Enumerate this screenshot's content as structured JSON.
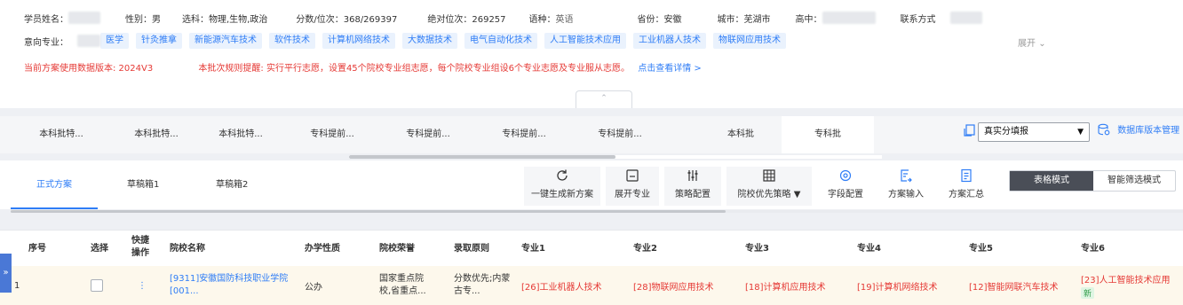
{
  "student": {
    "name_label": "学员姓名：",
    "gender_label": "性别：男",
    "subjects_label": "选科：物理,生物,政治",
    "score_label": "分数/位次：368/269397",
    "absolute_rank_label": "绝对位次：269257",
    "language_label": "语种：",
    "language_value": "英语",
    "province_label": "省份：安徽",
    "city_label": "城市：芜湖市",
    "highschool_label": "高中：",
    "contact_label": "联系方式"
  },
  "intent": {
    "label": "意向专业：",
    "majors": [
      "医学",
      "针灸推拿",
      "新能源汽车技术",
      "软件技术",
      "计算机网络技术",
      "大数据技术",
      "电气自动化技术",
      "人工智能技术应用",
      "工业机器人技术",
      "物联网应用技术"
    ],
    "expand_label": "展开"
  },
  "notice": {
    "data_version": "当前方案使用数据版本: 2024V3",
    "rule": "本批次规则提醒: 实行平行志愿，设置45个院校专业组志愿，每个院校专业组设6个专业志愿及专业服从志愿。",
    "link": "点击查看详情 >"
  },
  "batch_tabs": [
    "本科批特...",
    "本科批特...",
    "本科批特...",
    "专科提前...",
    "专科提前...",
    "专科提前...",
    "专科提前...",
    "本科批",
    "专科批"
  ],
  "batch_active_index": 8,
  "batch_scroll_fraction": 0.5,
  "mode_select": {
    "value": "真实分填报"
  },
  "db_version_label": "数据库版本管理",
  "plan_tabs": [
    "正式方案",
    "草稿箱1",
    "草稿箱2"
  ],
  "plan_active_index": 0,
  "tools": [
    {
      "label": "一键生成新方案",
      "icon": "refresh-icon"
    },
    {
      "label": "展开专业",
      "icon": "expand-icon"
    },
    {
      "label": "策略配置",
      "icon": "sliders-icon"
    },
    {
      "label": "院校优先策略",
      "icon": "grid-icon"
    },
    {
      "label": "字段配置",
      "icon": "target-icon"
    },
    {
      "label": "方案输入",
      "icon": "import-icon"
    },
    {
      "label": "方案汇总",
      "icon": "document-icon"
    }
  ],
  "view_modes": {
    "active": "表格模式",
    "inactive": "智能筛选模式"
  },
  "table_scroll_fraction": 0.61,
  "table": {
    "headers": [
      "序号",
      "选择",
      "快捷操作",
      "院校名称",
      "办学性质",
      "院校荣誉",
      "录取原则",
      "专业1",
      "专业2",
      "专业3",
      "专业4",
      "专业5",
      "专业6"
    ],
    "rows": [
      {
        "index": "1",
        "quick_action": "⋮",
        "school": "[9311]安徽国防科技职业学院[001...",
        "nature": "公办",
        "honors": "国家重点院校,省重点...",
        "principle": "分数优先;内蒙古专...",
        "majors": [
          "[26]工业机器人技术",
          "[28]物联网应用技术",
          "[18]计算机应用技术",
          "[19]计算机网络技术",
          "[12]智能网联汽车技术",
          "[23]人工智能技术应用"
        ],
        "major6_badge": "新"
      }
    ]
  },
  "colors": {
    "accent": "#2f7df6",
    "warning": "#e53935",
    "dark_toggle": "#4a4e57",
    "row_highlight": "#fdf8ec"
  }
}
